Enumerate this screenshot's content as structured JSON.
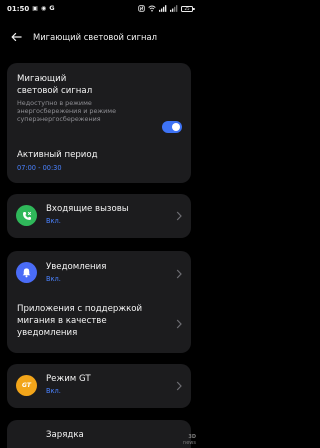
{
  "status_bar": {
    "time": "01:50",
    "battery_level": "25"
  },
  "header": {
    "title": "Мигающий световой сигнал"
  },
  "blink_card": {
    "title_line1": "Мигающий",
    "title_line2": "световой сигнал",
    "subtitle_line1": "Недоступно в режиме",
    "subtitle_line2": "энергосбережения и режиме",
    "subtitle_line3": "суперэнергосбережения",
    "toggle_on": true,
    "active_period_label": "Активный период",
    "active_period_value": "07:00 - 00:30"
  },
  "incoming_calls": {
    "label": "Входящие вызовы",
    "status": "Вкл.",
    "icon_color": "#2fb85a"
  },
  "notifications": {
    "label": "Уведомления",
    "status": "Вкл.",
    "icon_color": "#4a6cf7",
    "apps_line1": "Приложения с поддержкой",
    "apps_line2": "мигания в качестве",
    "apps_line3": "уведомления"
  },
  "gt_mode": {
    "label": "Режим GT",
    "status": "Вкл.",
    "icon_color": "#f2a51a",
    "icon_text": "GT"
  },
  "charging": {
    "label": "Зарядка"
  },
  "watermark": {
    "line1": "3D",
    "line2": "news"
  },
  "colors": {
    "background": "#000000",
    "card": "#1c1c1e",
    "accent": "#3e73f5",
    "secondary_text": "#8e8e93"
  }
}
